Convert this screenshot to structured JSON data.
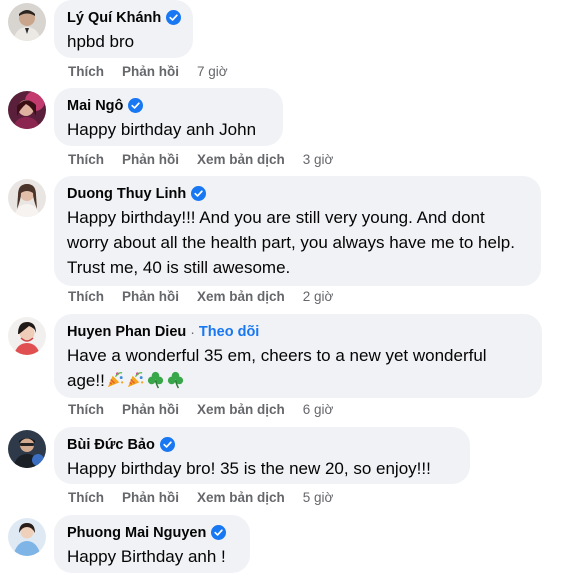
{
  "labels": {
    "like": "Thích",
    "reply": "Phản hồi",
    "translate": "Xem bản dịch",
    "follow": "Theo dõi",
    "separator": "·"
  },
  "colors": {
    "bubble": "#f0f2f5",
    "meta": "#65676b",
    "link": "#1877f2",
    "verified": "#1877f2"
  },
  "comments": [
    {
      "name": "Lý Quí Khánh",
      "verified": true,
      "text": "hpbd bro",
      "time": "7 giờ",
      "has_translate": false
    },
    {
      "name": "Mai Ngô",
      "verified": true,
      "text": "Happy birthday anh John",
      "time": "3 giờ",
      "has_translate": true
    },
    {
      "name": "Duong Thuy Linh",
      "verified": true,
      "text": "Happy birthday!!! And you are still very young. And dont worry about all the health part, you always have me to help. Trust me, 40 is still awesome.",
      "time": "2 giờ",
      "has_translate": true
    },
    {
      "name": "Huyen Phan Dieu",
      "verified": false,
      "text": "Have a wonderful 35 em, cheers to a new yet wonderful age!!",
      "emojis": [
        "party-popper-icon",
        "party-popper-icon",
        "shamrock-icon",
        "shamrock-icon"
      ],
      "time": "6 giờ",
      "has_translate": true
    },
    {
      "name": "Bùi Đức Bảo",
      "verified": true,
      "text": "Happy birthday bro! 35 is the new 20, so enjoy!!!",
      "time": "5 giờ",
      "has_translate": true
    },
    {
      "name": "Phuong Mai Nguyen",
      "verified": true,
      "text": "Happy Birthday anh !"
    }
  ]
}
